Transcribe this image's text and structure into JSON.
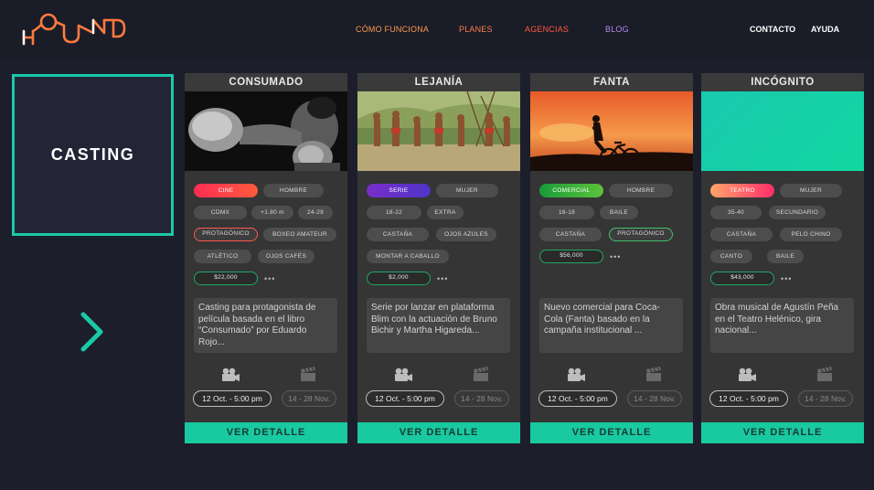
{
  "brand": {
    "logo_letters": [
      "H",
      "O",
      "U",
      "N",
      "D"
    ],
    "colors": {
      "orange": "#ff7a3d",
      "white": "#ffffff",
      "accent": "#19c9a8"
    }
  },
  "nav": {
    "items": [
      {
        "label": "CÓMO FUNCIONA",
        "color": "#ff9a4a"
      },
      {
        "label": "PLANES",
        "color": "#ff7e47"
      },
      {
        "label": "AGENCIAS",
        "color": "#ff5a3d"
      },
      {
        "label": "BLOG",
        "color": "#b48ae6"
      }
    ],
    "right": [
      "CONTACTO",
      "AYUDA"
    ]
  },
  "sidebar": {
    "title": "CASTING",
    "next_icon": "chevron-right-icon"
  },
  "cards": [
    {
      "title": "CONSUMADO",
      "image": "boxer-photo",
      "tags": [
        "CINE",
        "HOMBRE",
        "CDMX",
        "+1.80 m",
        "24-29",
        "PROTAGÓNICO",
        "BOXEO AMATEUR",
        "ATLÉTICO",
        "OJOS CAFÉS"
      ],
      "price": "$22,000",
      "more": "•••",
      "description": "Casting para protagonista de película basada en el libro “Consumado” por Eduardo Rojo...",
      "date": "12 Oct. - 5:00 pm",
      "range": "14 - 28 Nov.",
      "button": "VER DETALLE"
    },
    {
      "title": "LEJANÍA",
      "image": "tribe-photo",
      "tags": [
        "SERIE",
        "MUJER",
        "18-22",
        "EXTRA",
        "CASTAÑA",
        "OJOS AZULES",
        "MONTAR A CABALLO"
      ],
      "price": "$2,000",
      "more": "•••",
      "description": "Serie por lanzar en plataforma Blim con la actuación de Bruno Bichir y Martha Higareda...",
      "date": "12 Oct. - 5:00 pm",
      "range": "14 - 28 Nov.",
      "button": "VER DETALLE"
    },
    {
      "title": "FANTA",
      "image": "sunset-bike-photo",
      "tags": [
        "COMERCIAL",
        "HOMBRE",
        "16-18",
        "BAILE",
        "CASTAÑA",
        "PROTAGÓNICO"
      ],
      "price": "$56,000",
      "more": "•••",
      "description": "Nuevo comercial para Coca-Cola (Fanta) basado en la campaña institucional ...",
      "date": "12 Oct. - 5:00 pm",
      "range": "14 - 28 Nov.",
      "button": "VER DETALLE"
    },
    {
      "title": "INCÓGNITO",
      "image": "teal-placeholder",
      "tags": [
        "TEATRO",
        "MUJER",
        "35-40",
        "SECUNDARIO",
        "CASTAÑA",
        "PELO CHINO",
        "CANTO",
        "BAILE"
      ],
      "price": "$43,000",
      "more": "•••",
      "description": "Obra musical de Agustín Peña en el Teatro Helénico, gira nacional...",
      "date": "12 Oct. - 5:00 pm",
      "range": "14 - 28 Nov.",
      "button": "VER DETALLE"
    }
  ]
}
